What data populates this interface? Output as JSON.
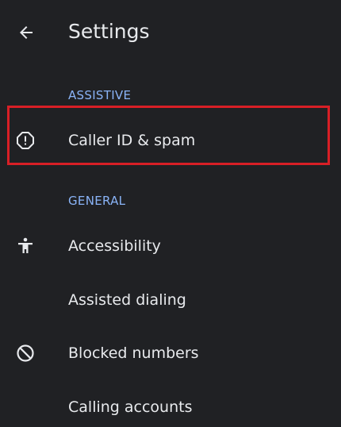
{
  "header": {
    "title": "Settings",
    "back_icon": "arrow-back-icon"
  },
  "sections": [
    {
      "heading": "ASSISTIVE",
      "items": [
        {
          "label": "Caller ID & spam",
          "icon": "caller-id-spam-icon"
        }
      ]
    },
    {
      "heading": "GENERAL",
      "items": [
        {
          "label": "Accessibility",
          "icon": "accessibility-icon"
        },
        {
          "label": "Assisted dialing",
          "icon": ""
        },
        {
          "label": "Blocked numbers",
          "icon": "block-icon"
        },
        {
          "label": "Calling accounts",
          "icon": ""
        }
      ]
    }
  ],
  "colors": {
    "background": "#202124",
    "text": "#e8eaed",
    "section_header": "#8ab4f8",
    "highlight_border": "#d81f26"
  }
}
